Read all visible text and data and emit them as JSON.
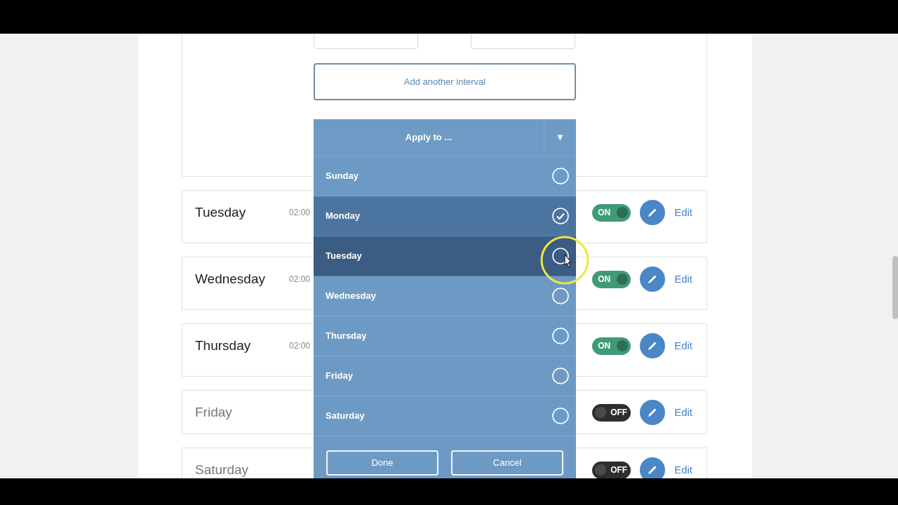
{
  "interval_button": "Add another interval",
  "apply_menu": {
    "title": "Apply to ...",
    "caret": "▼",
    "options": [
      {
        "label": "Sunday",
        "checked": false,
        "highlighted": false
      },
      {
        "label": "Monday",
        "checked": true,
        "highlighted": false
      },
      {
        "label": "Tuesday",
        "checked": false,
        "highlighted": true
      },
      {
        "label": "Wednesday",
        "checked": false,
        "highlighted": false
      },
      {
        "label": "Thursday",
        "checked": false,
        "highlighted": false
      },
      {
        "label": "Friday",
        "checked": false,
        "highlighted": false
      },
      {
        "label": "Saturday",
        "checked": false,
        "highlighted": false
      }
    ],
    "buttons": [
      "Done",
      "Cancel"
    ]
  },
  "days": [
    {
      "name": "Tuesday",
      "time": "02:00",
      "on": true,
      "toggle_label": "ON",
      "action": "Edit"
    },
    {
      "name": "Wednesday",
      "time": "02:00",
      "on": true,
      "toggle_label": "ON",
      "action": "Edit"
    },
    {
      "name": "Thursday",
      "time": "02:00",
      "on": true,
      "toggle_label": "ON",
      "action": "Edit"
    },
    {
      "name": "Friday",
      "on": false,
      "toggle_label": "OFF",
      "action": "Edit"
    },
    {
      "name": "Saturday",
      "on": false,
      "toggle_label": "OFF",
      "action": "Edit"
    }
  ]
}
